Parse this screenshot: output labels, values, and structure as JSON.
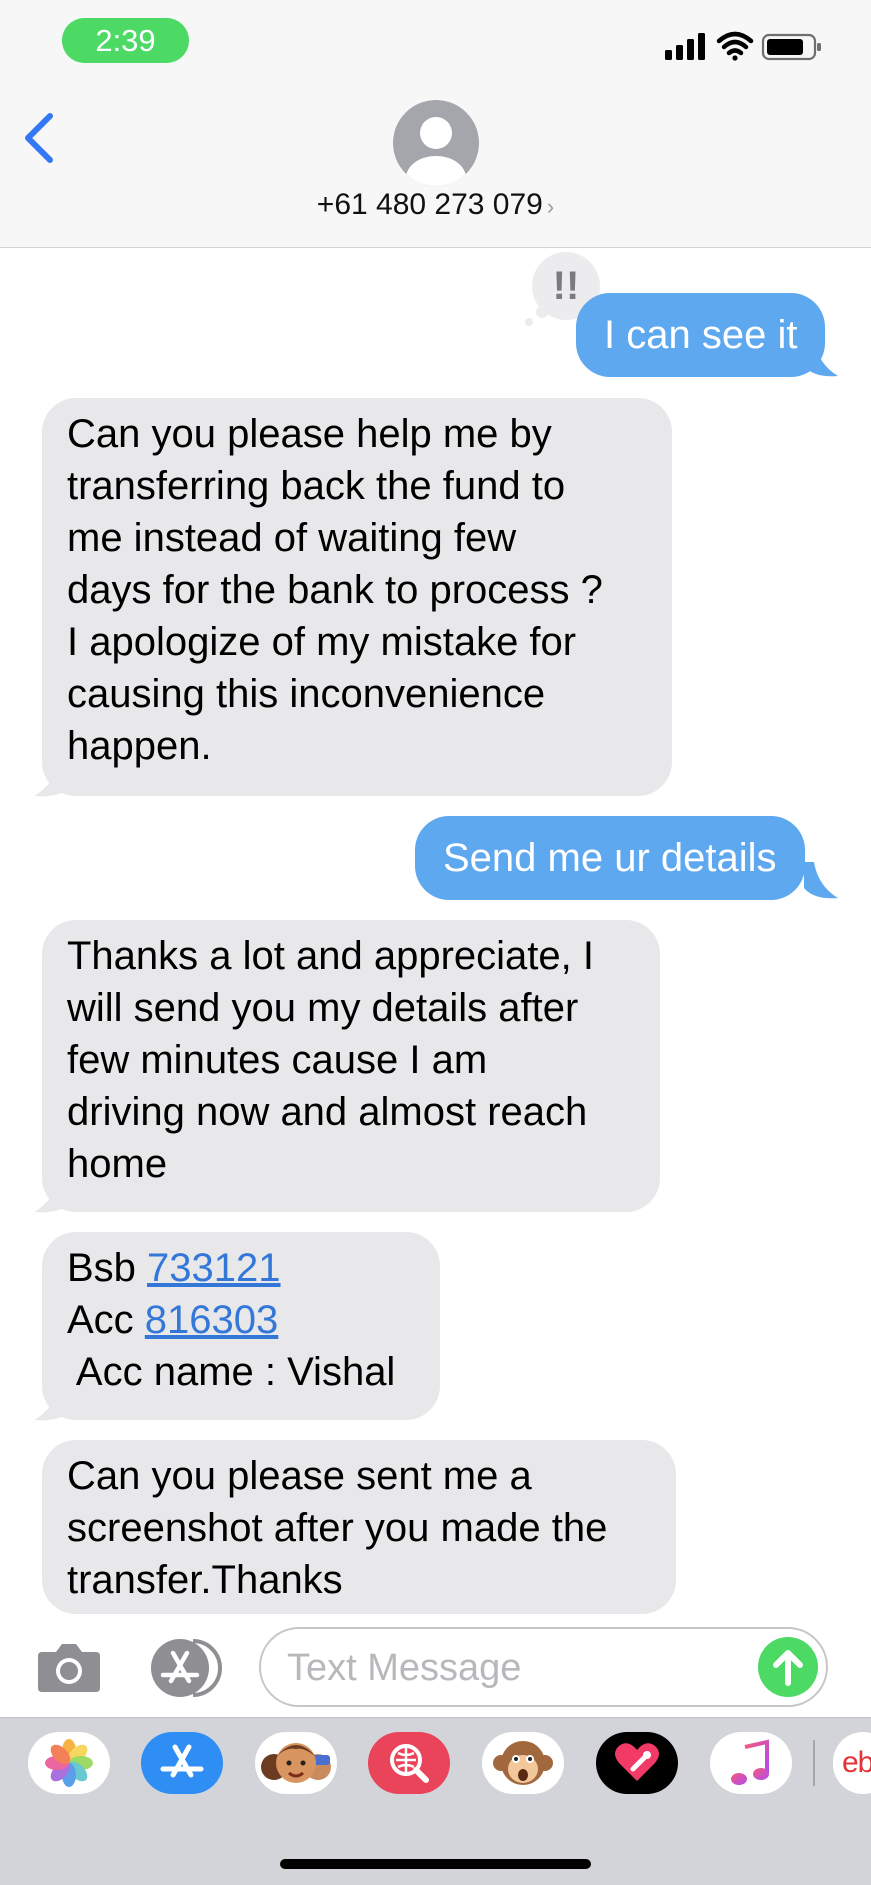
{
  "status_bar": {
    "time": "2:39"
  },
  "header": {
    "contact": "+61 480 273 079",
    "chevron": "›"
  },
  "messages": {
    "m1": {
      "text": "I can see it",
      "emphasis": "!!"
    },
    "m2": {
      "lines": [
        "Can you please help me by",
        "transferring back the fund to",
        "me instead of waiting few",
        "days for the bank to process ?",
        "I apologize of my mistake for",
        "causing this inconvenience",
        "happen."
      ]
    },
    "m3": {
      "text": "Send me ur details"
    },
    "m4": {
      "lines": [
        "Thanks a lot and appreciate, I",
        "will send you my details after",
        "few minutes cause I am",
        "driving now and almost reach",
        "home"
      ]
    },
    "m5": {
      "bsb_label": "Bsb ",
      "bsb": "733121",
      "acc_label": "Acc ",
      "acc": "816303",
      "acc_name": " Acc name : Vishal"
    },
    "m6": {
      "lines": [
        "Can you please sent me a",
        "screenshot after you made the",
        "transfer.Thanks"
      ]
    }
  },
  "compose": {
    "placeholder": "Text Message"
  },
  "drawer": {
    "apps": [
      "photos-icon",
      "app-store-icon",
      "memoji-icon",
      "web-search-icon",
      "animoji-icon",
      "digital-touch-icon",
      "music-icon",
      "ebay-icon"
    ],
    "partial_app_label": "eb"
  },
  "colors": {
    "sent": "#5ea8f0",
    "received": "#e8e8ea",
    "link": "#3377d9",
    "green": "#4cd964",
    "ios_blue": "#3478f6"
  }
}
